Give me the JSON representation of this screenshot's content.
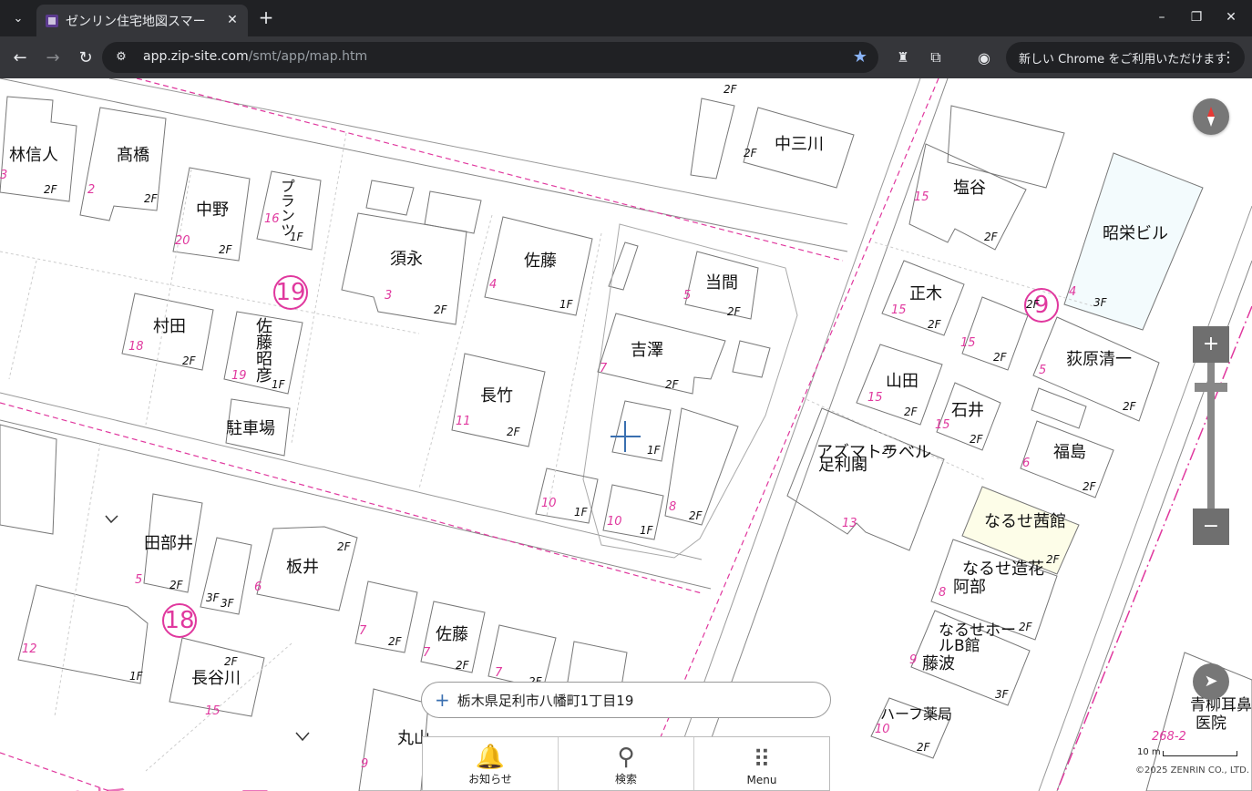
{
  "tab": {
    "title": "ゼンリン住宅地図スマー",
    "close": "✕"
  },
  "toolbar": {
    "url_host": "app.zip-site.com",
    "url_path": "/smt/app/map.htm",
    "update_label": "新しい Chrome をご利用いただけます"
  },
  "map": {
    "names": [
      "林信人",
      "髙橋",
      "中野",
      "プランツ",
      "須永",
      "佐藤",
      "中三川",
      "塩谷",
      "昭栄ビル",
      "当間",
      "村田",
      "佐藤昭彦",
      "駐車場",
      "長竹",
      "吉澤",
      "正木",
      "山田",
      "石井",
      "荻原清一",
      "福島",
      "アズマトラベル",
      "足利閣",
      "なるせ茜館",
      "なるせ造花",
      "阿部",
      "なるせホールB館",
      "藤波",
      "田部井",
      "板井",
      "佐藤",
      "長谷川",
      "丸山",
      "ハーフ薬局",
      "青柳耳鼻",
      "医院"
    ],
    "block_numbers": [
      "19",
      "9",
      "18"
    ],
    "lot_numbers": [
      "3",
      "2",
      "20",
      "16",
      "3",
      "4",
      "5",
      "15",
      "4",
      "18",
      "19",
      "11",
      "7",
      "15",
      "15",
      "5",
      "15",
      "15",
      "6",
      "13",
      "8",
      "5",
      "6",
      "12",
      "7",
      "7",
      "7",
      "15",
      "9",
      "10",
      "10",
      "10",
      "8",
      "9",
      "268-2"
    ],
    "floors": [
      "2F",
      "2F",
      "2F",
      "1F",
      "2F",
      "1F",
      "2F",
      "2F",
      "3F",
      "2F",
      "2F",
      "1F",
      "2F",
      "2F",
      "2F",
      "2F",
      "2F",
      "2F",
      "2F",
      "2F",
      "1F",
      "1F",
      "1F",
      "2F",
      "2F",
      "2F",
      "2F",
      "2F",
      "3F",
      "2F",
      "2F",
      "2F",
      "2F",
      "2F",
      "3F",
      "1F",
      "2F",
      "2F",
      "3F",
      "2F"
    ],
    "bottom_label": "八幡町１丁目"
  },
  "search": {
    "address": "栃木県足利市八幡町1丁目19"
  },
  "bottom_nav": {
    "notice": "お知らせ",
    "search": "検索",
    "menu": "Menu"
  },
  "scale": {
    "label": "10 m"
  },
  "copyright": "©2025 ZENRIN CO., LTD.",
  "colors": {
    "accent": "#e0389e",
    "control": "#6f6f6f"
  }
}
